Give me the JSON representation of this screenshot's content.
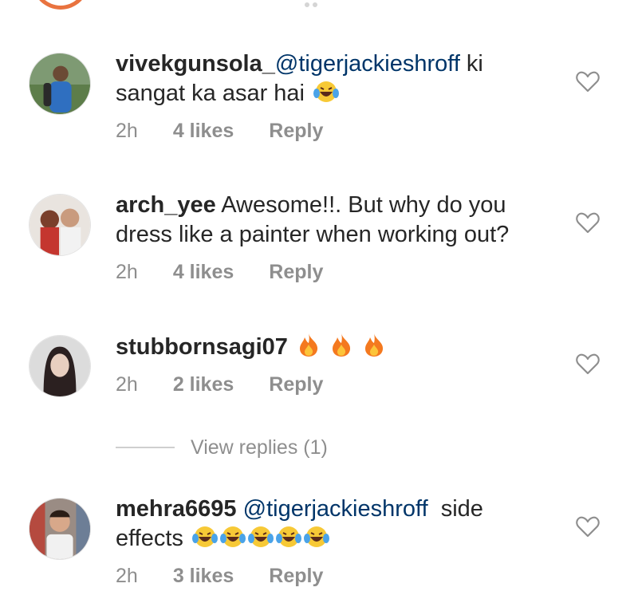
{
  "comments": [
    {
      "username": "vivekgunsola_",
      "mention": "@tigerjackieshroff",
      "text_line1": " ki",
      "text_line2": "sangat ka asar hai",
      "emoji": [
        "laughing-tears"
      ],
      "time": "2h",
      "likes": "4 likes",
      "reply": "Reply"
    },
    {
      "username": "arch_yee",
      "text_line1": " Awesome!!. But why do you",
      "text_line2": "dress like a painter when working out?",
      "time": "2h",
      "likes": "4 likes",
      "reply": "Reply"
    },
    {
      "username": "stubbornsagi07",
      "emoji": [
        "fire",
        "fire",
        "fire"
      ],
      "time": "2h",
      "likes": "2 likes",
      "reply": "Reply",
      "view_replies": "View replies (1)"
    },
    {
      "username": "mehra6695",
      "mention": "@tigerjackieshroff",
      "text_line1": "  side",
      "text_line2": "effects",
      "emoji": [
        "laughing-tears",
        "laughing-tears",
        "laughing-tears",
        "laughing-tears",
        "laughing-tears"
      ],
      "time": "2h",
      "likes": "3 likes",
      "reply": "Reply"
    }
  ],
  "colors": {
    "text": "#262626",
    "mention": "#003569",
    "meta": "#8e8e8e",
    "story_ring": "#e9733f"
  }
}
